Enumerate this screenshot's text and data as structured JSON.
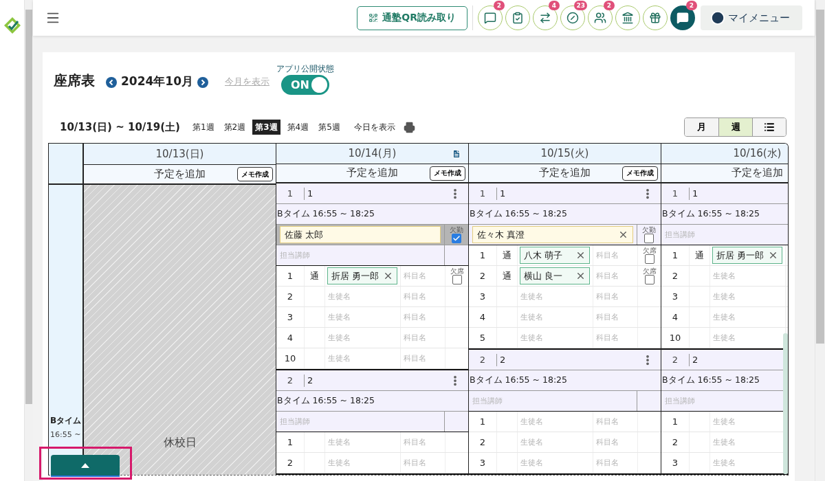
{
  "topbar": {
    "qr_button": "通塾QR読み取り",
    "icon_buttons": [
      {
        "kind": "outline",
        "badge": "2"
      },
      {
        "kind": "outline"
      },
      {
        "kind": "outline",
        "badge": "4"
      },
      {
        "kind": "outline",
        "badge": "23"
      },
      {
        "kind": "outline",
        "badge": "2"
      },
      {
        "kind": "outline"
      },
      {
        "kind": "outline"
      },
      {
        "kind": "filled",
        "badge": "2"
      }
    ],
    "my_menu": "マイメニュー"
  },
  "header": {
    "title": "座席表",
    "month": "2024年10月",
    "this_month_link": "今月を表示",
    "publish_label": "アプリ公開状態",
    "publish_toggle": {
      "label": "ON",
      "on": true
    }
  },
  "week_bar": {
    "range": "10/13(日) ~ 10/19(土)",
    "weeks": [
      {
        "label": "第1週",
        "selected": false
      },
      {
        "label": "第2週",
        "selected": false
      },
      {
        "label": "第3週",
        "selected": true
      },
      {
        "label": "第4週",
        "selected": false
      },
      {
        "label": "第5週",
        "selected": false
      }
    ],
    "today_link": "今日を表示",
    "views": [
      {
        "label": "月",
        "kind": "text",
        "selected": false
      },
      {
        "label": "週",
        "kind": "text",
        "selected": true
      },
      {
        "kind": "list",
        "selected": false
      }
    ]
  },
  "table": {
    "row_label": "Bタイム",
    "row_time": "16:55 ~",
    "days": [
      {
        "date": "10/13(日)",
        "note": false,
        "add": "予定を追加",
        "memo": "メモ作成",
        "holiday": "休校日"
      },
      {
        "date": "10/14(月)",
        "note": true,
        "add": "予定を追加",
        "memo": "メモ作成",
        "blocks": [
          {
            "seat": "1",
            "room": "1",
            "menu": true,
            "time": "Bタイム 16:55 ~ 18:25",
            "teacher": {
              "name": "佐藤 太郎",
              "clearable": false,
              "absent": true,
              "absence_label": "欠勤"
            },
            "substitute": "担当講師",
            "students": [
              {
                "number": "1",
                "type": "通",
                "name": "折居 勇一郎",
                "subject": "科目名",
                "absent": false,
                "absence_label": "欠席"
              },
              {
                "number": "2",
                "placeholder": "生徒名",
                "subject": "科目名"
              },
              {
                "number": "3",
                "placeholder": "生徒名",
                "subject": "科目名"
              },
              {
                "number": "4",
                "placeholder": "生徒名",
                "subject": "科目名"
              },
              {
                "number": "10",
                "placeholder": "生徒名",
                "subject": "科目名"
              }
            ]
          },
          {
            "seat": "2",
            "room": "2",
            "menu": true,
            "time": "Bタイム 16:55 ~ 18:25",
            "teacher": {
              "placeholder": "担当講師"
            },
            "students": [
              {
                "number": "1",
                "placeholder": "生徒名",
                "subject": "科目名"
              },
              {
                "number": "2",
                "placeholder": "生徒名",
                "subject": "科目名"
              }
            ]
          }
        ]
      },
      {
        "date": "10/15(火)",
        "note": false,
        "add": "予定を追加",
        "memo": "メモ作成",
        "blocks": [
          {
            "seat": "1",
            "room": "1",
            "menu": true,
            "time": "Bタイム 16:55 ~ 18:25",
            "teacher": {
              "name": "佐々木 真澄",
              "clearable": true,
              "absent": false,
              "absence_label": "欠勤"
            },
            "students": [
              {
                "number": "1",
                "type": "通",
                "name": "八木 萌子",
                "subject": "科目名",
                "absent": false,
                "absence_label": "欠席"
              },
              {
                "number": "2",
                "type": "通",
                "name": "横山 良一",
                "subject": "科目名",
                "absent": false,
                "absence_label": "欠席"
              },
              {
                "number": "3",
                "placeholder": "生徒名",
                "subject": "科目名"
              },
              {
                "number": "4",
                "placeholder": "生徒名",
                "subject": "科目名"
              },
              {
                "number": "5",
                "placeholder": "生徒名",
                "subject": "科目名"
              }
            ]
          },
          {
            "seat": "2",
            "room": "2",
            "menu": true,
            "time": "Bタイム 16:55 ~ 18:25",
            "teacher": {
              "placeholder": "担当講師"
            },
            "students": [
              {
                "number": "1",
                "placeholder": "生徒名",
                "subject": "科目名"
              },
              {
                "number": "2",
                "placeholder": "生徒名",
                "subject": "科目名"
              },
              {
                "number": "3",
                "placeholder": "生徒名",
                "subject": "科目名"
              }
            ]
          }
        ]
      },
      {
        "date": "10/16(水)",
        "add": "予定を追加",
        "blocks": [
          {
            "seat": "1",
            "room": "1",
            "time": "Bタイム 16:55 ~ 18:25",
            "teacher": {
              "placeholder": "担当講師"
            },
            "students": [
              {
                "number": "1",
                "type": "通",
                "name": "折居 勇一郎"
              },
              {
                "number": "2",
                "placeholder": "生徒名"
              },
              {
                "number": "3",
                "placeholder": "生徒名"
              },
              {
                "number": "4",
                "placeholder": "生徒名"
              },
              {
                "number": "10",
                "placeholder": "生徒名"
              }
            ]
          },
          {
            "seat": "2",
            "room": "2",
            "time": "Bタイム 16:55 ~ 18:25",
            "teacher": {
              "placeholder": "担当講師"
            },
            "students": [
              {
                "number": "1",
                "placeholder": "生徒名"
              },
              {
                "number": "2",
                "placeholder": "生徒名"
              },
              {
                "number": "3",
                "placeholder": "生徒名"
              }
            ]
          }
        ]
      }
    ]
  }
}
